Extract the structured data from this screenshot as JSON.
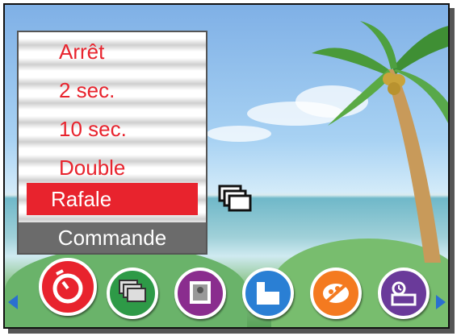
{
  "menu": {
    "items": [
      {
        "label": "Arrêt",
        "selected": false
      },
      {
        "label": "2 sec.",
        "selected": false
      },
      {
        "label": "10 sec.",
        "selected": false
      },
      {
        "label": "Double",
        "selected": false
      },
      {
        "label": "Rafale",
        "selected": true
      }
    ],
    "title": "Commande"
  },
  "side_icon": "burst-mode-icon",
  "mode_bar": {
    "icons": [
      {
        "name": "self-timer-icon",
        "color": "#e8232d",
        "selected": true
      },
      {
        "name": "burst-icon",
        "color": "#2e9a47"
      },
      {
        "name": "portrait-frame-icon",
        "color": "#8a2d8e"
      },
      {
        "name": "image-size-icon",
        "color": "#2a7fd4"
      },
      {
        "name": "effect-palette-icon",
        "color": "#f47a20"
      },
      {
        "name": "date-stamp-icon",
        "color": "#6a3a9a"
      }
    ],
    "arrow_color": "#2a6fd0"
  }
}
